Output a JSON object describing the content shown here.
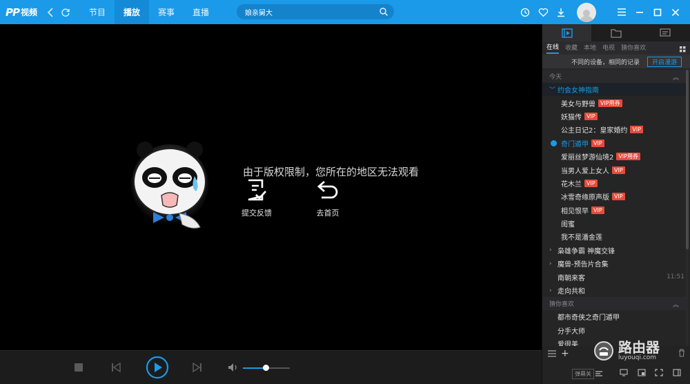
{
  "app": {
    "logo_mark": "PP",
    "logo_text": "视频"
  },
  "nav": {
    "items": [
      {
        "label": "节目",
        "active": false
      },
      {
        "label": "播放",
        "active": true
      },
      {
        "label": "赛事",
        "active": false
      },
      {
        "label": "直播",
        "active": false
      }
    ]
  },
  "search": {
    "value": "娘亲舅大"
  },
  "player": {
    "message": "由于版权限制，您所在的地区无法观看",
    "feedback_label": "提交反馈",
    "home_label": "去首页",
    "volume_level": 0.48
  },
  "sidebar": {
    "subtabs": [
      "在线",
      "收藏",
      "本地",
      "电视",
      "猜你喜欢"
    ],
    "sync_text": "不同的设备，相同的记录",
    "sync_button": "开启漫游",
    "section_today": "今天",
    "open_group": "约会女神指南",
    "children": [
      {
        "title": "美女与野兽",
        "badge": "VIP用券"
      },
      {
        "title": "妖猫传",
        "badge": "VIP"
      },
      {
        "title": "公主日记2：皇家婚约",
        "badge": "VIP"
      },
      {
        "title": "奇门遁甲",
        "badge": "VIP",
        "playing": true
      },
      {
        "title": "爱丽丝梦游仙境2",
        "badge": "VIP用券"
      },
      {
        "title": "当男人爱上女人",
        "badge": "VIP"
      },
      {
        "title": "花木兰",
        "badge": "VIP"
      },
      {
        "title": "冰雪奇缘原声版",
        "badge": "VIP"
      },
      {
        "title": "相见恨早",
        "badge": "VIP"
      },
      {
        "title": "闺蜜",
        "badge": ""
      },
      {
        "title": "我不是潘金莲",
        "badge": ""
      }
    ],
    "groups": [
      {
        "title": "枭雄争霸 神魔交锋",
        "caret": true,
        "time": ""
      },
      {
        "title": "魔兽-预告片合集",
        "caret": true,
        "time": ""
      },
      {
        "title": "南朝来客",
        "caret": false,
        "time": "11:51"
      },
      {
        "title": "走向共和",
        "caret": true,
        "time": ""
      }
    ],
    "section_guess": "猜你喜欢",
    "guess": [
      "都市奇侠之奇门遁甲",
      "分手大师",
      "爱很美"
    ],
    "barrage_label": "弹幕关"
  },
  "watermark": {
    "text": "路由器",
    "sub": "luyouqi.com"
  },
  "colors": {
    "accent": "#1a9ae8",
    "badge": "#e84a3a",
    "topbar": "#1a9ae8"
  }
}
